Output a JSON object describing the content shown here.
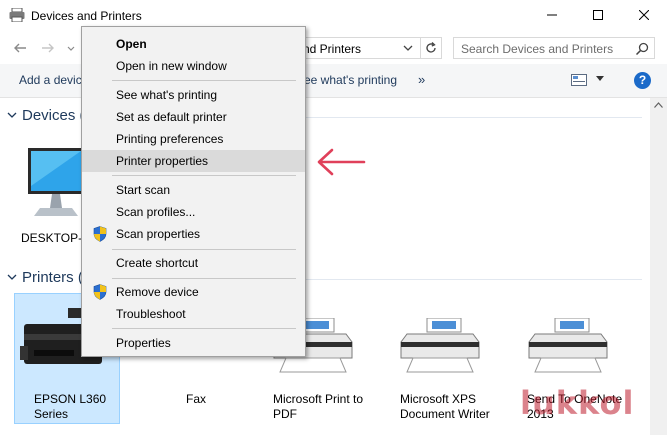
{
  "window": {
    "title": "Devices and Printers",
    "min_glyph": "—",
    "max_glyph": "☐",
    "close_glyph": "✕"
  },
  "addressbar": {
    "path": "nd Printers",
    "search_placeholder": "Search Devices and Printers"
  },
  "commandbar": {
    "add_device": "Add a devic",
    "see_printing": "ee what's printing",
    "more": "»",
    "help": "?"
  },
  "groups": {
    "devices": "Devices (",
    "printers": "Printers ("
  },
  "devices": [
    {
      "label": "DESKTOP-V"
    }
  ],
  "printers": [
    {
      "label_line1": "EPSON L360",
      "label_line2": "Series",
      "selected": true
    },
    {
      "label_line1": "Fax",
      "label_line2": ""
    },
    {
      "label_line1": "Microsoft Print to",
      "label_line2": "PDF"
    },
    {
      "label_line1": "Microsoft XPS",
      "label_line2": "Document Writer"
    },
    {
      "label_line1": "Send To OneNote",
      "label_line2": "2013"
    }
  ],
  "context_menu": {
    "items": [
      {
        "label": "Open",
        "bold": true
      },
      {
        "label": "Open in new window"
      },
      {
        "label": "See what's printing"
      },
      {
        "label": "Set as default printer"
      },
      {
        "label": "Printing preferences"
      },
      {
        "label": "Printer properties",
        "highlighted": true
      },
      {
        "label": "Start scan"
      },
      {
        "label": "Scan profiles..."
      },
      {
        "label": "Scan properties",
        "icon": "shield-icon"
      },
      {
        "label": "Create shortcut"
      },
      {
        "label": "Remove device",
        "icon": "shield-icon"
      },
      {
        "label": "Troubleshoot"
      },
      {
        "label": "Properties"
      }
    ]
  },
  "watermark": "lukkol",
  "colors": {
    "accent": "#1b6ac9",
    "selection": "#cce8ff",
    "menu_highlight": "#dadada",
    "arrow": "#e0405a"
  }
}
